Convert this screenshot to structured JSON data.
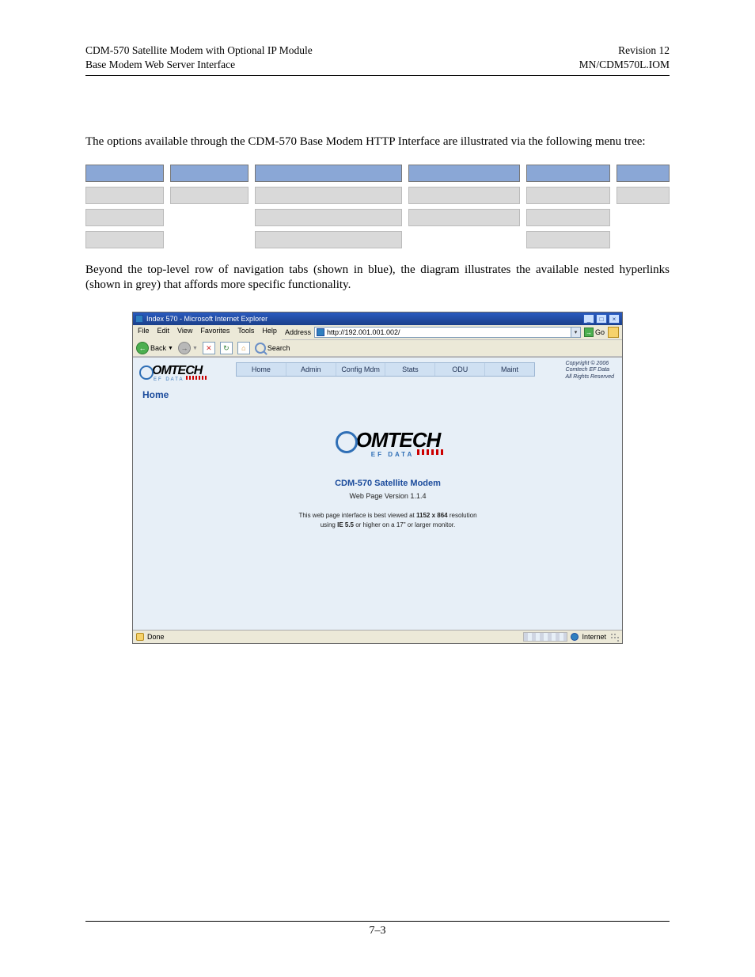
{
  "header": {
    "left_line1": "CDM-570 Satellite Modem with Optional IP Module",
    "left_line2": "Base Modem Web Server Interface",
    "right_line1": "Revision 12",
    "right_line2": "MN/CDM570L.IOM"
  },
  "para1": "The options available through the CDM-570 Base Modem HTTP Interface are illustrated via the following menu tree:",
  "para2": "Beyond the top-level row of navigation tabs (shown in blue), the diagram illustrates the available nested hyperlinks (shown in grey) that affords more specific functionality.",
  "ie": {
    "title": "Index 570 - Microsoft Internet Explorer",
    "menus": [
      "File",
      "Edit",
      "View",
      "Favorites",
      "Tools",
      "Help"
    ],
    "address_label": "Address",
    "address_value": "http://192.001.001.002/",
    "go_label": "Go",
    "toolbar": {
      "back": "Back",
      "search": "Search"
    },
    "status_left": "Done",
    "status_right": "Internet"
  },
  "app": {
    "logo_text": "OMTECH",
    "logo_sub": "EF DATA",
    "nav": [
      "Home",
      "Admin",
      "Config Mdm",
      "Stats",
      "ODU",
      "Maint"
    ],
    "copyright_l1": "Copyright © 2006",
    "copyright_l2": "Comtech EF Data",
    "copyright_l3": "All Rights Reserved",
    "section": "Home",
    "modem_name": "CDM-570 Satellite Modem",
    "web_version": "Web Page Version 1.1.4",
    "note_l1a": "This web page interface is best viewed at ",
    "note_l1b": "1152 x 864",
    "note_l1c": " resolution",
    "note_l2a": "using ",
    "note_l2b": "IE 5.5",
    "note_l2c": " or higher on a 17\" or larger monitor."
  },
  "page_number": "7–3"
}
